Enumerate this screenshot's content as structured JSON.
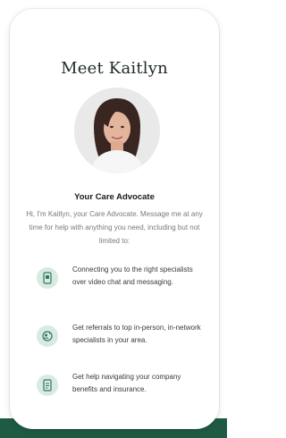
{
  "card": {
    "title": "Meet Kaitlyn",
    "subtitle": "Your Care Advocate",
    "intro": "Hi, I'm Kaitlyn, your Care Advocate. Message me at any time for help with anything you need, including but not limited to:"
  },
  "features": [
    {
      "icon": "phone-icon",
      "text": "Connecting you to the right specialists over video chat and messaging."
    },
    {
      "icon": "referral-icon",
      "text": "Get referrals to top in-person, in-network specialists in your area."
    },
    {
      "icon": "document-icon",
      "text": "Get help navigating your company benefits and insurance."
    }
  ],
  "colors": {
    "accent": "#1f5b44",
    "icon_bg": "#d9eae2",
    "icon_stroke": "#2f7a5b"
  }
}
